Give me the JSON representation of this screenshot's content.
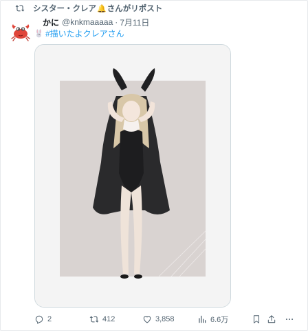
{
  "repost": {
    "text_before": "シスター・クレア",
    "text_after": "さんがリポスト",
    "icon": "repost-icon",
    "bell_icon": "bell-icon"
  },
  "author": {
    "name": "かに",
    "handle": "@knkmaaaaa",
    "date": "7月11日",
    "avatar_icon": "crab-avatar"
  },
  "post": {
    "emoji_icon": "bunny-icon",
    "hashtag": "#描いたよクレアさん"
  },
  "media": {
    "description_icon": "illustration-image"
  },
  "actions": {
    "reply_count": "2",
    "repost_count": "412",
    "like_count": "3,858",
    "view_count": "6.6万"
  },
  "colors": {
    "accent": "#1d9bf0",
    "muted": "#536471",
    "text": "#0f1419"
  }
}
